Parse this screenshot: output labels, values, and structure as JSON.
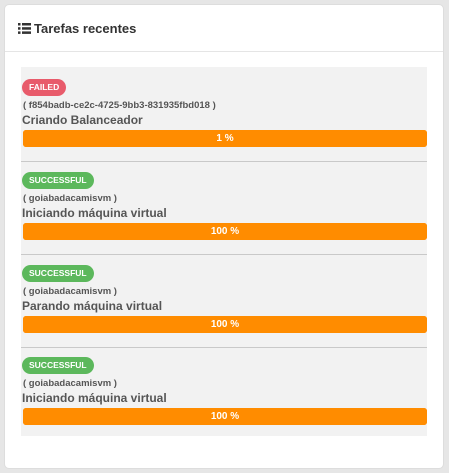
{
  "panel": {
    "title": "Tarefas recentes",
    "icon": "list-icon"
  },
  "tasks": [
    {
      "status": "FAILED",
      "status_color": "#e85b6b",
      "target": "( f854badb-ce2c-4725-9bb3-831935fbd018 )",
      "name": "Criando Balanceador",
      "progress": 1,
      "progress_label": "1 %"
    },
    {
      "status": "SUCCESSFUL",
      "status_color": "#5cb85c",
      "target": "( goiabadacamisvm )",
      "name": "Iniciando máquina virtual",
      "progress": 100,
      "progress_label": "100 %"
    },
    {
      "status": "SUCCESSFUL",
      "status_color": "#5cb85c",
      "target": "( goiabadacamisvm )",
      "name": "Parando máquina virtual",
      "progress": 100,
      "progress_label": "100 %"
    },
    {
      "status": "SUCCESSFUL",
      "status_color": "#5cb85c",
      "target": "( goiabadacamisvm )",
      "name": "Iniciando máquina virtual",
      "progress": 100,
      "progress_label": "100 %"
    }
  ],
  "colors": {
    "progress_bar": "#ff8c00",
    "failed": "#e85b6b",
    "successful": "#5cb85c"
  }
}
